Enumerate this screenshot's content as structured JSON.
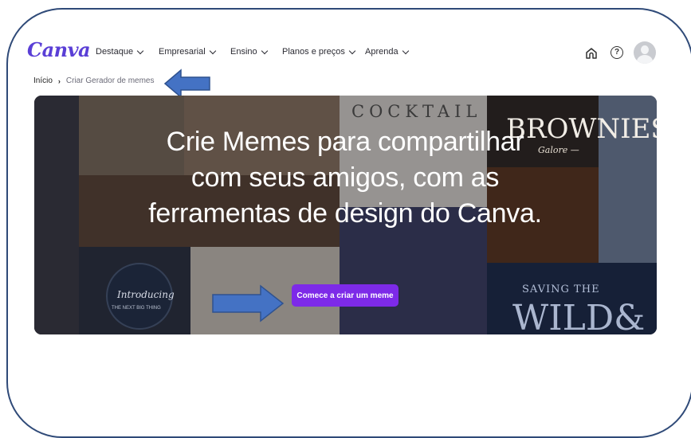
{
  "header": {
    "logo": "Canva",
    "nav": [
      {
        "label": "Destaque"
      },
      {
        "label": "Empresarial"
      },
      {
        "label": "Ensino"
      },
      {
        "label": "Planos e preços"
      },
      {
        "label": "Aprenda"
      }
    ],
    "icons": [
      "home-icon",
      "help-icon",
      "avatar"
    ]
  },
  "breadcrumb": {
    "home": "Início",
    "separator": "›",
    "current": "Criar Gerador de memes"
  },
  "hero": {
    "title": "Crie Memes para compartilhar com seus amigos, com as ferramentas de design do Canva.",
    "cta_label": "Comece a criar um meme",
    "bg_text": {
      "cocktail": "COCKTAIL",
      "brownies": "BROWNIES",
      "galore": "Galore —",
      "introducing": "Introducing",
      "next_big": "THE NEXT BIG THING",
      "saving": "SAVING THE",
      "wild": "WILD&"
    }
  },
  "colors": {
    "brand": "#7d2ae8",
    "annotation_arrow": "#4472c4",
    "frame_border": "#2f4a78"
  }
}
